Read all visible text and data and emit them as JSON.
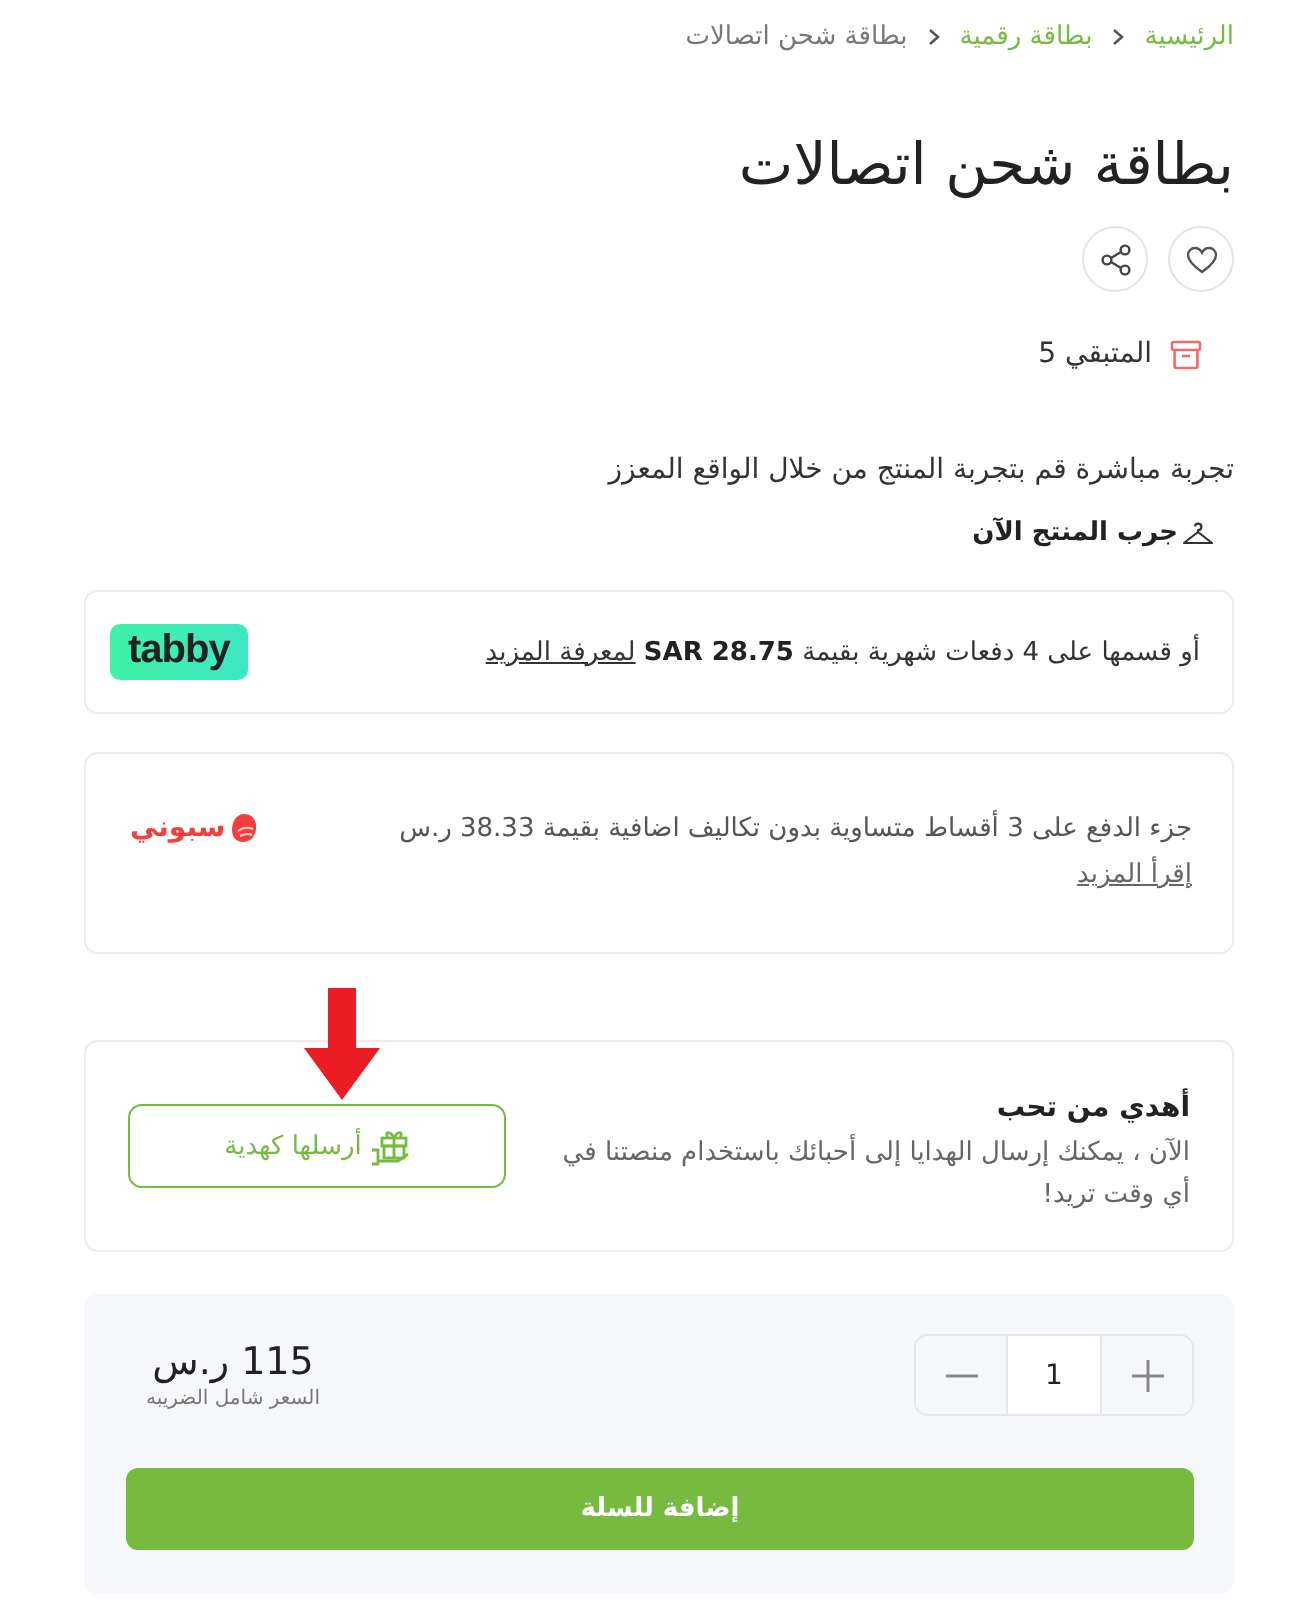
{
  "breadcrumb": [
    {
      "label": "الرئيسية",
      "current": false
    },
    {
      "label": "بطاقة رقمية",
      "current": false
    },
    {
      "label": "بطاقة شحن اتصالات",
      "current": true
    }
  ],
  "product": {
    "title": "بطاقة شحن اتصالات",
    "stock": "المتبقي 5"
  },
  "ar_try": {
    "description": "تجربة مباشرة قم بتجربة المنتج من خلال الواقع المعزز",
    "link": "جرب المنتج الآن"
  },
  "installments": [
    {
      "kind": "badge",
      "text": "أو قسمها على 4 دفعات شهرية بقيمة **SAR 28.75**",
      "link": "لمعرفة المزيد",
      "logo": "tabby"
    },
    {
      "kind": "mark",
      "text": "جزء الدفع على 3 أقساط متساوية بدون تكاليف اضافية بقيمة 38.33 ر.س",
      "link": "إقرأ المزيد",
      "logo": "سبوني"
    }
  ],
  "gift": {
    "title": "أهدي من تحب",
    "text": "الآن ، يمكنك إرسال الهدايا إلى أحبائك باستخدام منصتنا في أي وقت تريد!",
    "button": "أرسلها كهدية"
  },
  "purchase": {
    "quantity": "1",
    "price": "115 ر.س",
    "price_note": "السعر شامل الضريبه",
    "button": "إضافة للسلة"
  }
}
